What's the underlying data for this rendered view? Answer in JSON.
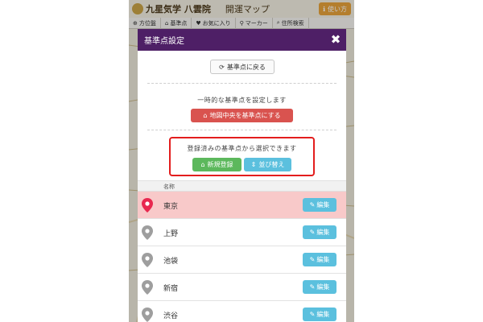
{
  "app": {
    "title": "九星気学 八雲院",
    "subtitle": "開運マップ",
    "howto_label": "使い方",
    "toolbar": [
      {
        "icon": "compass-icon",
        "label": "方位盤"
      },
      {
        "icon": "home-icon",
        "label": "基準点"
      },
      {
        "icon": "heart-icon",
        "label": "お気に入り"
      },
      {
        "icon": "marker-icon",
        "label": "マーカー"
      },
      {
        "icon": "search-icon",
        "label": "住所検索"
      }
    ]
  },
  "modal": {
    "title": "基準点設定",
    "close_glyph": "✖",
    "back_button": {
      "icon": "refresh-icon",
      "label": "基準点に戻る"
    },
    "temp_text": "一時的な基準点を設定します",
    "center_button": {
      "icon": "home-icon",
      "label": "地図中央を基準点にする"
    },
    "registered_text": "登録済みの基準点から選択できます",
    "new_button": {
      "icon": "home-icon",
      "label": "新規登録"
    },
    "sort_button": {
      "icon": "sort-icon",
      "label": "並び替え"
    },
    "list_header": {
      "name": "名称"
    },
    "edit_label": "編集",
    "items": [
      {
        "name": "東京",
        "selected": true,
        "pin_color": "#e8284f"
      },
      {
        "name": "上野",
        "selected": false,
        "pin_color": "#9e9e9e"
      },
      {
        "name": "池袋",
        "selected": false,
        "pin_color": "#9e9e9e"
      },
      {
        "name": "新宿",
        "selected": false,
        "pin_color": "#9e9e9e"
      },
      {
        "name": "渋谷",
        "selected": false,
        "pin_color": "#9e9e9e"
      }
    ]
  },
  "colors": {
    "modal_header": "#4e1f66",
    "danger": "#d9534f",
    "success": "#5cb85c",
    "info": "#5bc0de",
    "highlight_border": "#e31d1d",
    "selected_row": "#f8c9c9"
  }
}
